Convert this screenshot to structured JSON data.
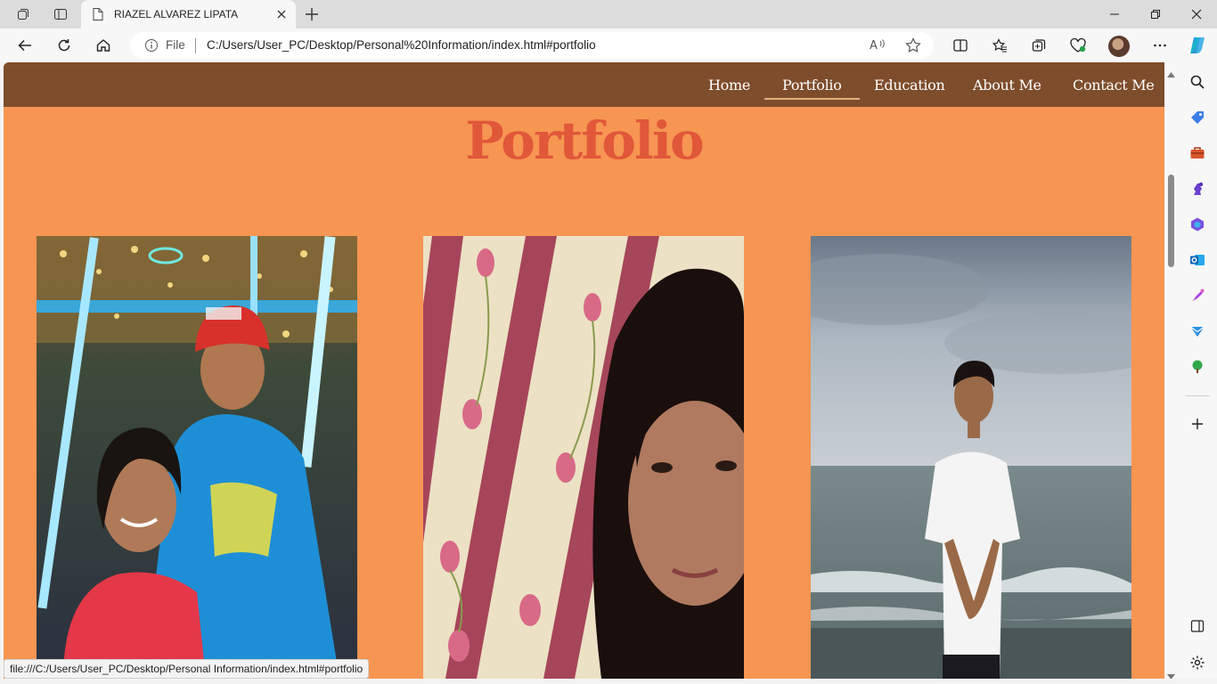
{
  "tab": {
    "title": "RIAZEL ALVAREZ LIPATA"
  },
  "address_bar": {
    "scheme_label": "File",
    "url": "C:/Users/User_PC/Desktop/Personal%20Information/index.html#portfolio"
  },
  "site_nav": {
    "links": [
      {
        "label": "Home",
        "active": false
      },
      {
        "label": "Portfolio",
        "active": true
      },
      {
        "label": "Education",
        "active": false
      },
      {
        "label": "About Me",
        "active": false
      },
      {
        "label": "Contact Me",
        "active": false
      }
    ]
  },
  "section": {
    "title": "Portfolio"
  },
  "photos": [
    {
      "name": "couple-festival-photo"
    },
    {
      "name": "woman-selfie-photo"
    },
    {
      "name": "man-at-beach-photo"
    }
  ],
  "status_bar": {
    "text": "file:///C:/Users/User_PC/Desktop/Personal Information/index.html#portfolio"
  },
  "colors": {
    "page_background": "#f79552",
    "nav_background": "#7e4d2c",
    "title_color": "#e0573a",
    "nav_text": "#ffffff"
  },
  "icons": {
    "tab_actions": "tab-actions-icon",
    "vertical_tabs": "vertical-tabs-icon",
    "page_favicon": "page-icon",
    "new_tab": "plus-icon",
    "back": "back-arrow-icon",
    "refresh": "refresh-icon",
    "home": "home-icon",
    "read_aloud": "read-aloud-icon",
    "favorite": "star-icon"
  }
}
